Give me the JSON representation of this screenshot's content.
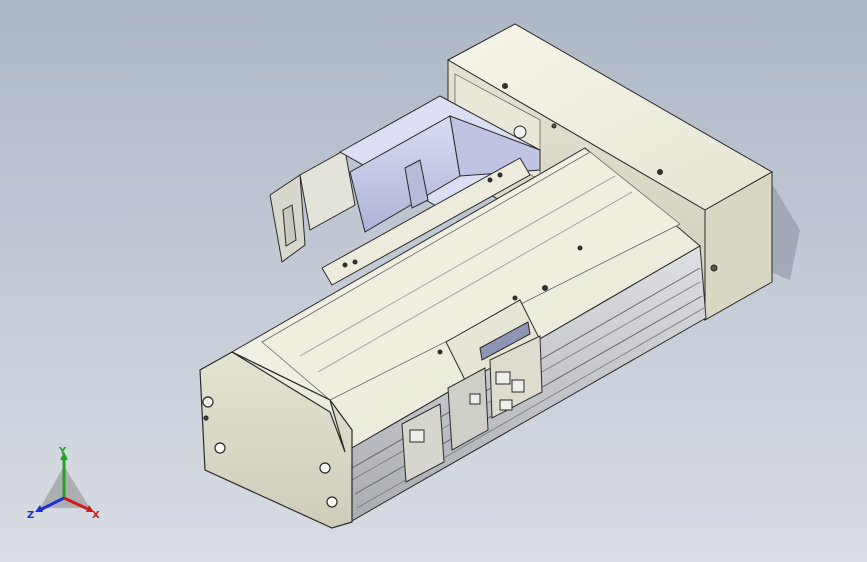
{
  "view": {
    "background_top": "#aeb7c6",
    "background_bottom": "#d9dde4"
  },
  "triad": {
    "x_label": "X",
    "y_label": "Y",
    "z_label": "Z",
    "x_color": "#d11a1a",
    "y_color": "#1fa51f",
    "z_color": "#1a2fd1"
  },
  "model": {
    "description_icon": "cad-linear-actuator-icon",
    "housing_color": "#ecebdc",
    "motor_color": "#c9cde8",
    "rail_color": "#c2c4c8"
  }
}
